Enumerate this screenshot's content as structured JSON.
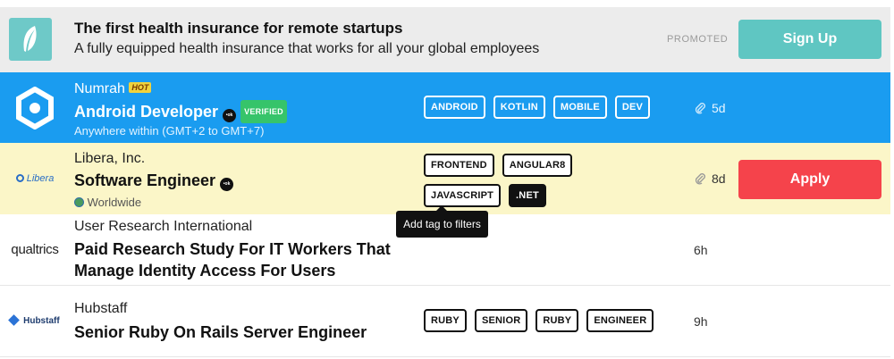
{
  "promo": {
    "title": "The first health insurance for remote startups",
    "subtitle": "A fully equipped health insurance that works for all your global employees",
    "promoted_label": "PROMOTED",
    "signup_label": "Sign Up",
    "accent": "#5fc6c2"
  },
  "jobs": [
    {
      "company": "Numrah",
      "hot_badge": "HOT",
      "title": "Android Developer",
      "badge_glyph": "•ok",
      "verified_badge": "VERIFIED",
      "location": "Anywhere within (GMT+2 to GMT+7)",
      "tags": [
        "ANDROID",
        "KOTLIN",
        "MOBILE",
        "DEV"
      ],
      "time": "5d",
      "row_color": "#1a9cf0"
    },
    {
      "company": "Libera, Inc.",
      "logo_text": "Libera",
      "title": "Software Engineer",
      "badge_glyph": "•ok",
      "location": "Worldwide",
      "tags": [
        "FRONTEND",
        "ANGULAR8",
        "JAVASCRIPT",
        ".NET"
      ],
      "time": "8d",
      "apply_label": "Apply",
      "row_color": "#fbf6c8"
    },
    {
      "company": "User Research International",
      "logo_text": "qualtrics",
      "title_line1": "Paid Research Study For IT Workers That",
      "title_line2": "Manage Identity Access For Users",
      "time": "6h"
    },
    {
      "company": "Hubstaff",
      "logo_text": "Hubstaff",
      "title": "Senior Ruby On Rails Server Engineer",
      "tags": [
        "RUBY",
        "SENIOR",
        "RUBY",
        "ENGINEER"
      ],
      "time": "9h"
    }
  ],
  "tooltip": "Add tag to filters"
}
